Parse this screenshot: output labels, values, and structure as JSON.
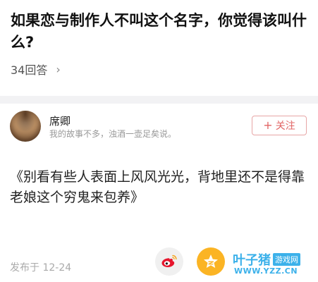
{
  "question": {
    "title": "如果恋与制作人不叫这个名字，你觉得该叫什么?",
    "answer_count": "34回答",
    "chevron": "›"
  },
  "answer": {
    "author_name": "席卿",
    "author_bio": "我的故事不多，浊酒一壶足矣说。",
    "follow_label": "关注",
    "follow_plus": "+",
    "content": "《别看有些人表面上风风光光，背地里还不是得靠老娘这个穷鬼来包养》",
    "post_date": "发布于 12-24"
  },
  "share": {
    "weibo_icon": "weibo-icon",
    "qzone_icon": "qzone-star-icon"
  },
  "watermark": {
    "main": "叶子猪",
    "badge": "游戏网",
    "url": "WWW.YZZ.CN"
  },
  "colors": {
    "accent": "#e26565",
    "divider": "#f2f2f4",
    "weibo": "#e6162d",
    "qzone": "#fbb424",
    "watermark": "#3cb1ea"
  }
}
